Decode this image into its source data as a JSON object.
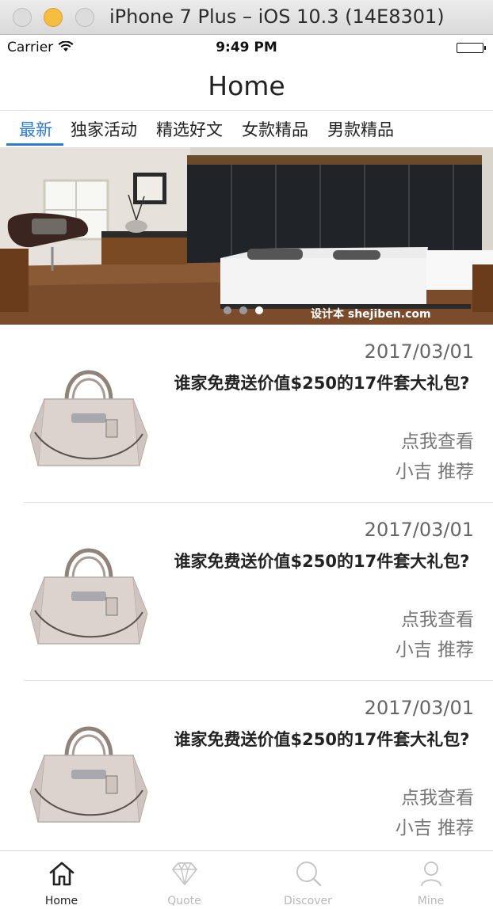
{
  "window": {
    "title": "iPhone 7 Plus – iOS 10.3 (14E8301)"
  },
  "status_bar": {
    "carrier": "Carrier",
    "time": "9:49 PM"
  },
  "nav": {
    "title": "Home"
  },
  "tabs": [
    {
      "label": "最新",
      "active": true
    },
    {
      "label": "独家活动",
      "active": false
    },
    {
      "label": "精选好文",
      "active": false
    },
    {
      "label": "女款精品",
      "active": false
    },
    {
      "label": "男款精品",
      "active": false
    }
  ],
  "banner": {
    "watermark": "设计本 shejiben.com",
    "page_count": 3,
    "current_page": 3
  },
  "articles": [
    {
      "date": "2017/03/01",
      "title": "谁家免费送价值$250的17件套大礼包?",
      "cta": "点我查看",
      "recommend": "小吉 推荐"
    },
    {
      "date": "2017/03/01",
      "title": "谁家免费送价值$250的17件套大礼包?",
      "cta": "点我查看",
      "recommend": "小吉 推荐"
    },
    {
      "date": "2017/03/01",
      "title": "谁家免费送价值$250的17件套大礼包?",
      "cta": "点我查看",
      "recommend": "小吉 推荐"
    }
  ],
  "tab_bar": [
    {
      "label": "Home",
      "icon": "house-icon",
      "active": true
    },
    {
      "label": "Quote",
      "icon": "diamond-icon",
      "active": false
    },
    {
      "label": "Discover",
      "icon": "search-icon",
      "active": false
    },
    {
      "label": "Mine",
      "icon": "person-icon",
      "active": false
    }
  ],
  "colors": {
    "accent": "#2c7bd1",
    "text": "#222222",
    "muted": "#777777",
    "inactive_tab": "#b8b8b8"
  }
}
